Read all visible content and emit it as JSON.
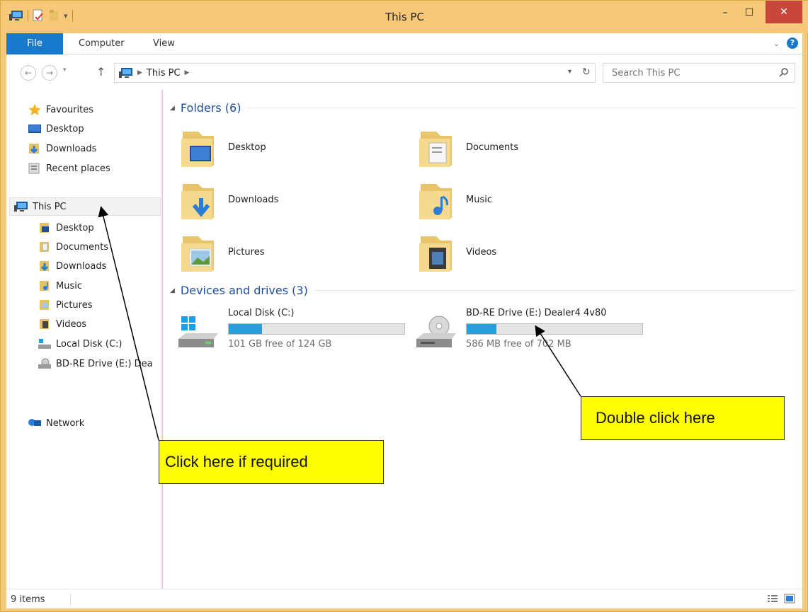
{
  "window": {
    "title": "This PC",
    "controls": {
      "minimize": "–",
      "maximize": "☐",
      "close": "✕"
    }
  },
  "ribbon": {
    "tabs": [
      "File",
      "Computer",
      "View"
    ],
    "expand_icon": "chevron-down-icon",
    "help": "?"
  },
  "navigation": {
    "back_icon": "←",
    "forward_icon": "→",
    "recent_icon": "▾",
    "up_icon": "↑",
    "address": {
      "location": "This PC"
    },
    "refresh_icon": "↻",
    "dropdown_icon": "▾",
    "search": {
      "placeholder": "Search This PC"
    }
  },
  "nav_pane": {
    "favourites": {
      "label": "Favourites",
      "items": [
        "Desktop",
        "Downloads",
        "Recent places"
      ]
    },
    "this_pc": {
      "label": "This PC",
      "items": [
        "Desktop",
        "Documents",
        "Downloads",
        "Music",
        "Pictures",
        "Videos",
        "Local Disk (C:)",
        "BD-RE Drive (E:) Dea"
      ]
    },
    "network": {
      "label": "Network"
    }
  },
  "content": {
    "folders": {
      "header": "Folders (6)",
      "items": [
        "Desktop",
        "Documents",
        "Downloads",
        "Music",
        "Pictures",
        "Videos"
      ]
    },
    "devices": {
      "header": "Devices and drives (3)",
      "drives": [
        {
          "name": "Local Disk (C:)",
          "free": "101 GB free of 124 GB",
          "used_fraction": 0.19
        },
        {
          "name": "BD-RE Drive (E:) Dealer4 4v80",
          "free": "586 MB free of 702 MB",
          "used_fraction": 0.17
        }
      ]
    }
  },
  "status": {
    "items": "9 items"
  },
  "annotations": {
    "callout_1": "Click here if required",
    "callout_2": "Double click here"
  },
  "colors": {
    "accent": "#1979ca",
    "titlebar": "#f7c877",
    "close": "#c9463d",
    "drive_fill": "#26a0da",
    "callout": "#ffff00"
  }
}
